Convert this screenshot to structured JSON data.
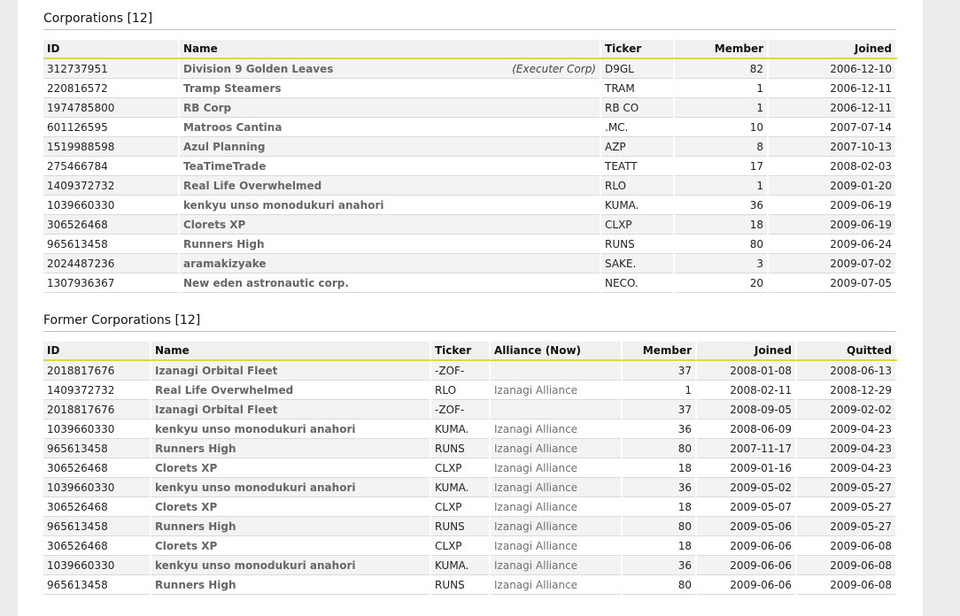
{
  "corporations": {
    "title": "Corporations [12]",
    "headers": {
      "id": "ID",
      "name": "Name",
      "ticker": "Ticker",
      "member": "Member",
      "joined": "Joined"
    },
    "rows": [
      {
        "id": "312737951",
        "name": "Division 9 Golden Leaves",
        "note": "(Executer Corp)",
        "ticker": "D9GL",
        "member": "82",
        "joined": "2006-12-10"
      },
      {
        "id": "220816572",
        "name": "Tramp Steamers",
        "note": "",
        "ticker": "TRAM",
        "member": "1",
        "joined": "2006-12-11"
      },
      {
        "id": "1974785800",
        "name": "RB Corp",
        "note": "",
        "ticker": "RB CO",
        "member": "1",
        "joined": "2006-12-11"
      },
      {
        "id": "601126595",
        "name": "Matroos Cantina",
        "note": "",
        "ticker": ".MC.",
        "member": "10",
        "joined": "2007-07-14"
      },
      {
        "id": "1519988598",
        "name": "Azul Planning",
        "note": "",
        "ticker": "AZP",
        "member": "8",
        "joined": "2007-10-13"
      },
      {
        "id": "275466784",
        "name": "TeaTimeTrade",
        "note": "",
        "ticker": "TEATT",
        "member": "17",
        "joined": "2008-02-03"
      },
      {
        "id": "1409372732",
        "name": "Real Life Overwhelmed",
        "note": "",
        "ticker": "RLO",
        "member": "1",
        "joined": "2009-01-20"
      },
      {
        "id": "1039660330",
        "name": "kenkyu unso monodukuri anahori",
        "note": "",
        "ticker": "KUMA.",
        "member": "36",
        "joined": "2009-06-19"
      },
      {
        "id": "306526468",
        "name": "Clorets XP",
        "note": "",
        "ticker": "CLXP",
        "member": "18",
        "joined": "2009-06-19"
      },
      {
        "id": "965613458",
        "name": "Runners High",
        "note": "",
        "ticker": "RUNS",
        "member": "80",
        "joined": "2009-06-24"
      },
      {
        "id": "2024487236",
        "name": "aramakizyake",
        "note": "",
        "ticker": "SAKE.",
        "member": "3",
        "joined": "2009-07-02"
      },
      {
        "id": "1307936367",
        "name": "New eden astronautic corp.",
        "note": "",
        "ticker": "NECO.",
        "member": "20",
        "joined": "2009-07-05"
      }
    ]
  },
  "former_corporations": {
    "title": "Former Corporations [12]",
    "headers": {
      "id": "ID",
      "name": "Name",
      "ticker": "Ticker",
      "alliance": "Alliance (Now)",
      "member": "Member",
      "joined": "Joined",
      "quitted": "Quitted"
    },
    "rows": [
      {
        "id": "2018817676",
        "name": "Izanagi Orbital Fleet",
        "ticker": "-ZOF-",
        "alliance": "",
        "member": "37",
        "joined": "2008-01-08",
        "quitted": "2008-06-13"
      },
      {
        "id": "1409372732",
        "name": "Real Life Overwhelmed",
        "ticker": "RLO",
        "alliance": "Izanagi Alliance",
        "member": "1",
        "joined": "2008-02-11",
        "quitted": "2008-12-29"
      },
      {
        "id": "2018817676",
        "name": "Izanagi Orbital Fleet",
        "ticker": "-ZOF-",
        "alliance": "",
        "member": "37",
        "joined": "2008-09-05",
        "quitted": "2009-02-02"
      },
      {
        "id": "1039660330",
        "name": "kenkyu unso monodukuri anahori",
        "ticker": "KUMA.",
        "alliance": "Izanagi Alliance",
        "member": "36",
        "joined": "2008-06-09",
        "quitted": "2009-04-23"
      },
      {
        "id": "965613458",
        "name": "Runners High",
        "ticker": "RUNS",
        "alliance": "Izanagi Alliance",
        "member": "80",
        "joined": "2007-11-17",
        "quitted": "2009-04-23"
      },
      {
        "id": "306526468",
        "name": "Clorets XP",
        "ticker": "CLXP",
        "alliance": "Izanagi Alliance",
        "member": "18",
        "joined": "2009-01-16",
        "quitted": "2009-04-23"
      },
      {
        "id": "1039660330",
        "name": "kenkyu unso monodukuri anahori",
        "ticker": "KUMA.",
        "alliance": "Izanagi Alliance",
        "member": "36",
        "joined": "2009-05-02",
        "quitted": "2009-05-27"
      },
      {
        "id": "306526468",
        "name": "Clorets XP",
        "ticker": "CLXP",
        "alliance": "Izanagi Alliance",
        "member": "18",
        "joined": "2009-05-07",
        "quitted": "2009-05-27"
      },
      {
        "id": "965613458",
        "name": "Runners High",
        "ticker": "RUNS",
        "alliance": "Izanagi Alliance",
        "member": "80",
        "joined": "2009-05-06",
        "quitted": "2009-05-27"
      },
      {
        "id": "306526468",
        "name": "Clorets XP",
        "ticker": "CLXP",
        "alliance": "Izanagi Alliance",
        "member": "18",
        "joined": "2009-06-06",
        "quitted": "2009-06-08"
      },
      {
        "id": "1039660330",
        "name": "kenkyu unso monodukuri anahori",
        "ticker": "KUMA.",
        "alliance": "Izanagi Alliance",
        "member": "36",
        "joined": "2009-06-06",
        "quitted": "2009-06-08"
      },
      {
        "id": "965613458",
        "name": "Runners High",
        "ticker": "RUNS",
        "alliance": "Izanagi Alliance",
        "member": "80",
        "joined": "2009-06-06",
        "quitted": "2009-06-08"
      }
    ]
  }
}
